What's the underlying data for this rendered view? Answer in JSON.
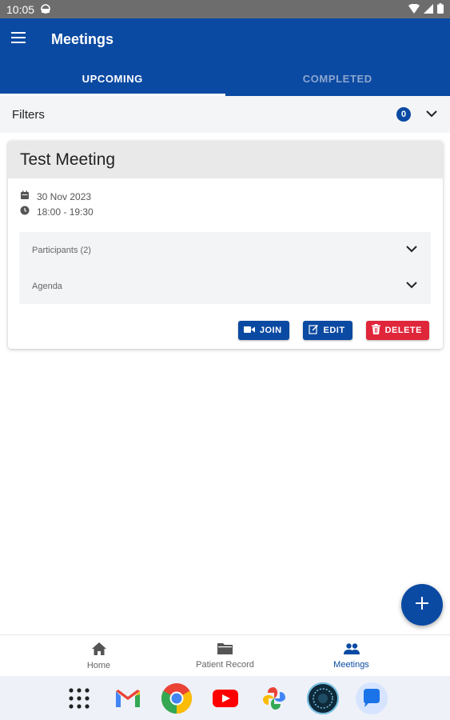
{
  "status_bar": {
    "time": "10:05"
  },
  "app_bar": {
    "title": "Meetings"
  },
  "tabs": [
    {
      "label": "UPCOMING",
      "active": true
    },
    {
      "label": "COMPLETED",
      "active": false
    }
  ],
  "filters": {
    "label": "Filters",
    "count": "0"
  },
  "meeting": {
    "title": "Test Meeting",
    "date": "30 Nov 2023",
    "time": "18:00 - 19:30",
    "sections": [
      {
        "label": "Participants (2)"
      },
      {
        "label": "Agenda"
      }
    ],
    "actions": {
      "join": "JOIN",
      "edit": "EDIT",
      "delete": "DELETE"
    }
  },
  "bottom_nav": [
    {
      "label": "Home",
      "icon": "home-icon",
      "active": false
    },
    {
      "label": "Patient Record",
      "icon": "folder-icon",
      "active": false
    },
    {
      "label": "Meetings",
      "icon": "people-icon",
      "active": true
    }
  ],
  "dock": [
    "app-grid-icon",
    "gmail-icon",
    "chrome-icon",
    "youtube-icon",
    "photos-icon",
    "camera-app-icon",
    "messages-icon"
  ],
  "colors": {
    "primary": "#0b4aa2",
    "danger": "#e0263a",
    "status_bar": "#6d6d6d"
  }
}
